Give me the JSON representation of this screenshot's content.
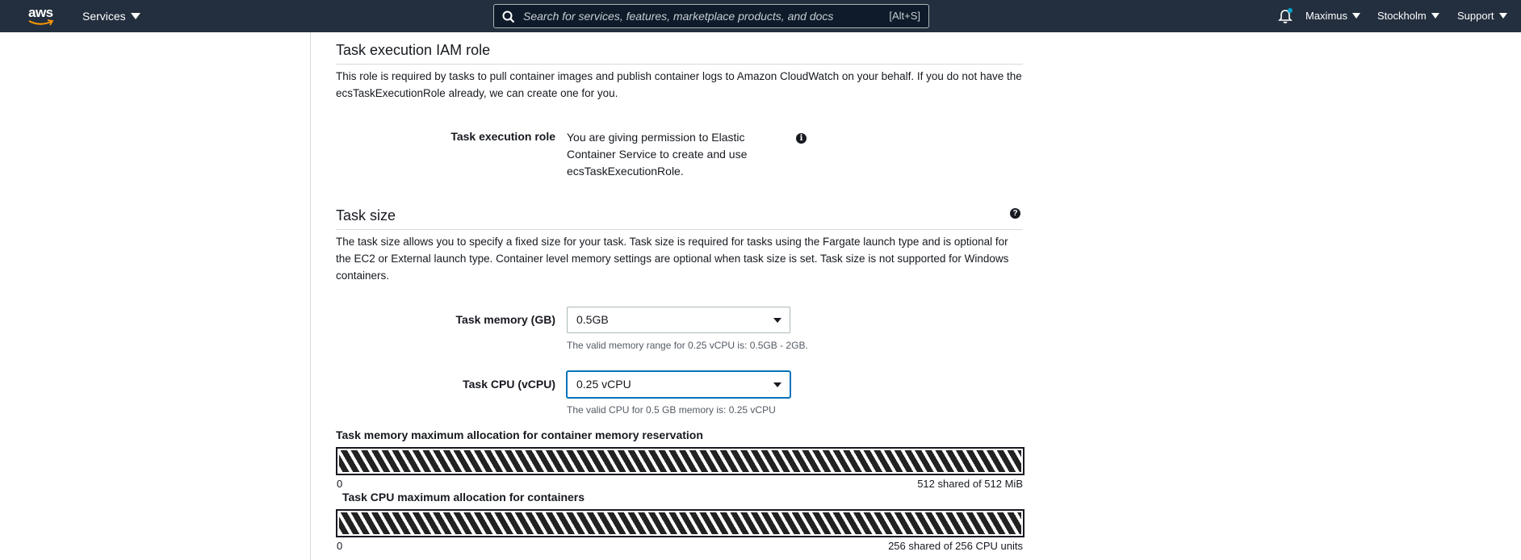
{
  "nav": {
    "logo_text": "aws",
    "services_label": "Services",
    "search_placeholder": "Search for services, features, marketplace products, and docs",
    "search_shortcut": "[Alt+S]",
    "user": "Maximus",
    "region": "Stockholm",
    "support": "Support",
    "accent": "#00a1c9"
  },
  "iam": {
    "title": "Task execution IAM role",
    "description": "This role is required by tasks to pull container images and publish container logs to Amazon CloudWatch on your behalf. If you do not have the ecsTaskExecutionRole already, we can create one for you.",
    "role_label": "Task execution role",
    "role_text": "You are giving permission to Elastic Container Service to create and use ecsTaskExecutionRole.",
    "info_icon": "i"
  },
  "task_size": {
    "title": "Task size",
    "help_icon": "?",
    "description": "The task size allows you to specify a fixed size for your task. Task size is required for tasks using the Fargate launch type and is optional for the EC2 or External launch type. Container level memory settings are optional when task size is set. Task size is not supported for Windows containers.",
    "memory_label": "Task memory (GB)",
    "memory_value": "0.5GB",
    "memory_hint": "The valid memory range for 0.25 vCPU is: 0.5GB - 2GB.",
    "cpu_label": "Task CPU (vCPU)",
    "cpu_value": "0.25 vCPU",
    "cpu_hint": "The valid CPU for 0.5 GB memory is: 0.25 vCPU"
  },
  "allocation": {
    "memory_title": "Task memory maximum allocation for container memory reservation",
    "memory_min": "0",
    "memory_max": "512 shared of 512 MiB",
    "cpu_title": "Task CPU maximum allocation for containers",
    "cpu_min": "0",
    "cpu_max": "256 shared of 256 CPU units"
  }
}
